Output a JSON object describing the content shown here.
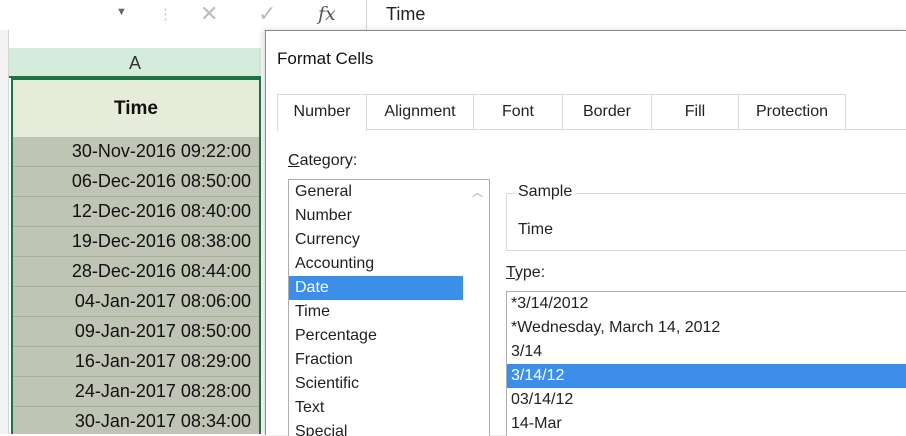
{
  "formula_bar": {
    "namebox_dropdown_icon": "caret-down-icon",
    "separator": "⋮",
    "cancel_glyph": "✕",
    "enter_glyph": "✓",
    "fx_label": "fx",
    "content": "Time"
  },
  "sheet": {
    "column_header": "A",
    "header_cell": "Time",
    "rows": [
      "30-Nov-2016 09:22:00",
      "06-Dec-2016 08:50:00",
      "12-Dec-2016 08:40:00",
      "19-Dec-2016 08:38:00",
      "28-Dec-2016 08:44:00",
      "04-Jan-2017 08:06:00",
      "09-Jan-2017 08:50:00",
      "16-Jan-2017 08:29:00",
      "24-Jan-2017 08:28:00",
      "30-Jan-2017 08:34:00"
    ],
    "colors": {
      "selection_border": "#217346",
      "header_fill": "#e6ecd9",
      "data_fill": "#bfc4b4",
      "column_header_fill": "#d3ecdc"
    }
  },
  "dialog": {
    "title": "Format Cells",
    "tabs": [
      "Number",
      "Alignment",
      "Font",
      "Border",
      "Fill",
      "Protection"
    ],
    "active_tab": "Number",
    "category_label_accel": "C",
    "category_label_rest": "ategory:",
    "categories": [
      "General",
      "Number",
      "Currency",
      "Accounting",
      "Date",
      "Time",
      "Percentage",
      "Fraction",
      "Scientific",
      "Text",
      "Special"
    ],
    "selected_category": "Date",
    "sample_label": "Sample",
    "sample_value": "Time",
    "type_label_accel": "T",
    "type_label_rest": "ype:",
    "types": [
      "*3/14/2012",
      "*Wednesday, March 14, 2012",
      "3/14",
      "3/14/12",
      "03/14/12",
      "14-Mar"
    ],
    "selected_type": "3/14/12",
    "colors": {
      "selection": "#3d8ee9"
    }
  }
}
